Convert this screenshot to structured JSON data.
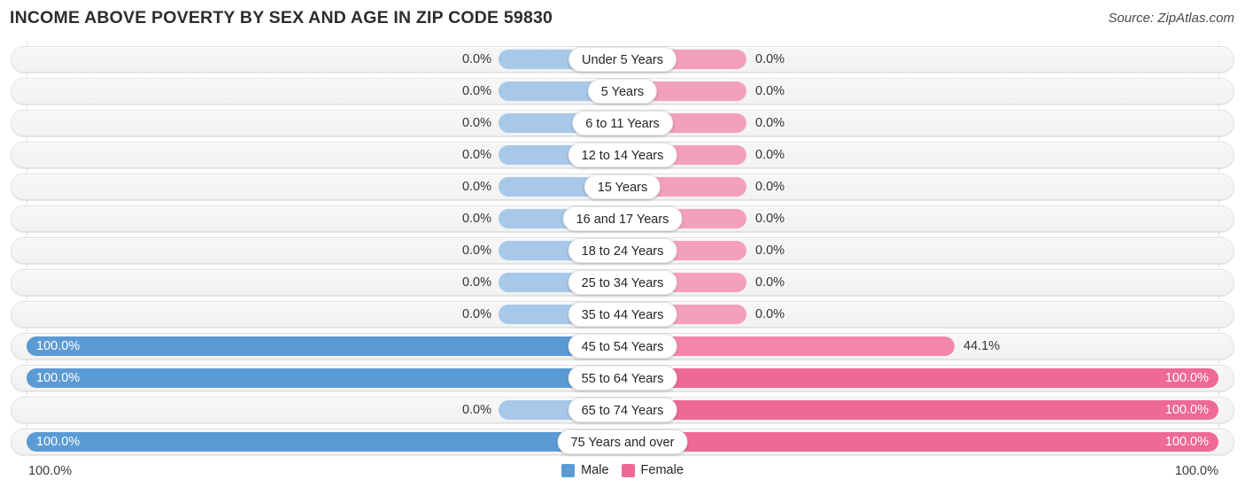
{
  "header": {
    "title": "INCOME ABOVE POVERTY BY SEX AND AGE IN ZIP CODE 59830",
    "source": "Source: ZipAtlas.com"
  },
  "legend": {
    "male_label": "Male",
    "female_label": "Female",
    "male_color": "#5b9bd5",
    "female_color": "#ee6995"
  },
  "axis": {
    "left_label": "100.0%",
    "right_label": "100.0%"
  },
  "chart_data": {
    "type": "bar",
    "orientation": "horizontal-diverging",
    "title": "INCOME ABOVE POVERTY BY SEX AND AGE IN ZIP CODE 59830",
    "xlabel": "",
    "ylabel": "",
    "xlim": [
      0,
      100
    ],
    "grid": true,
    "legend_position": "bottom-center",
    "categories": [
      "Under 5 Years",
      "5 Years",
      "6 to 11 Years",
      "12 to 14 Years",
      "15 Years",
      "16 and 17 Years",
      "18 to 24 Years",
      "25 to 34 Years",
      "35 to 44 Years",
      "45 to 54 Years",
      "55 to 64 Years",
      "65 to 74 Years",
      "75 Years and over"
    ],
    "series": [
      {
        "name": "Male",
        "color": "#5b9bd5",
        "zero_color": "#a8c8ea",
        "values": [
          0.0,
          0.0,
          0.0,
          0.0,
          0.0,
          0.0,
          0.0,
          0.0,
          0.0,
          100.0,
          100.0,
          0.0,
          100.0
        ],
        "labels": [
          "0.0%",
          "0.0%",
          "0.0%",
          "0.0%",
          "0.0%",
          "0.0%",
          "0.0%",
          "0.0%",
          "0.0%",
          "100.0%",
          "100.0%",
          "0.0%",
          "100.0%"
        ]
      },
      {
        "name": "Female",
        "color": "#ee6995",
        "mid_color": "#f586ab",
        "zero_color": "#f4a0bd",
        "values": [
          0.0,
          0.0,
          0.0,
          0.0,
          0.0,
          0.0,
          0.0,
          0.0,
          0.0,
          44.1,
          100.0,
          100.0,
          100.0
        ],
        "labels": [
          "0.0%",
          "0.0%",
          "0.0%",
          "0.0%",
          "0.0%",
          "0.0%",
          "0.0%",
          "0.0%",
          "0.0%",
          "44.1%",
          "100.0%",
          "100.0%",
          "100.0%"
        ]
      }
    ]
  }
}
